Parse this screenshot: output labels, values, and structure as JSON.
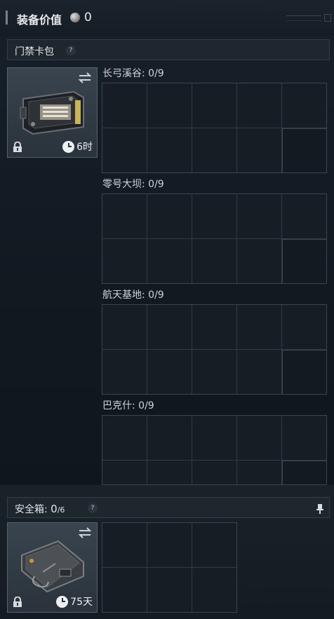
{
  "header": {
    "title": "装备价值",
    "value": "0"
  },
  "keycard_section": {
    "label": "门禁卡包",
    "help": "?"
  },
  "keycard_item": {
    "timer": "6时"
  },
  "maps": [
    {
      "label": "长弓溪谷: 0/9"
    },
    {
      "label": "零号大坝: 0/9"
    },
    {
      "label": "航天基地: 0/9"
    },
    {
      "label": "巴克什: 0/9"
    }
  ],
  "safebox": {
    "label_prefix": "安全箱: ",
    "current": "0",
    "capacity": "/6",
    "help": "?",
    "timer": "75天"
  },
  "colors": {
    "background": "#0f151b",
    "panel": "#1e262e",
    "grid_line": "#323a43",
    "text": "#d6dadd"
  }
}
